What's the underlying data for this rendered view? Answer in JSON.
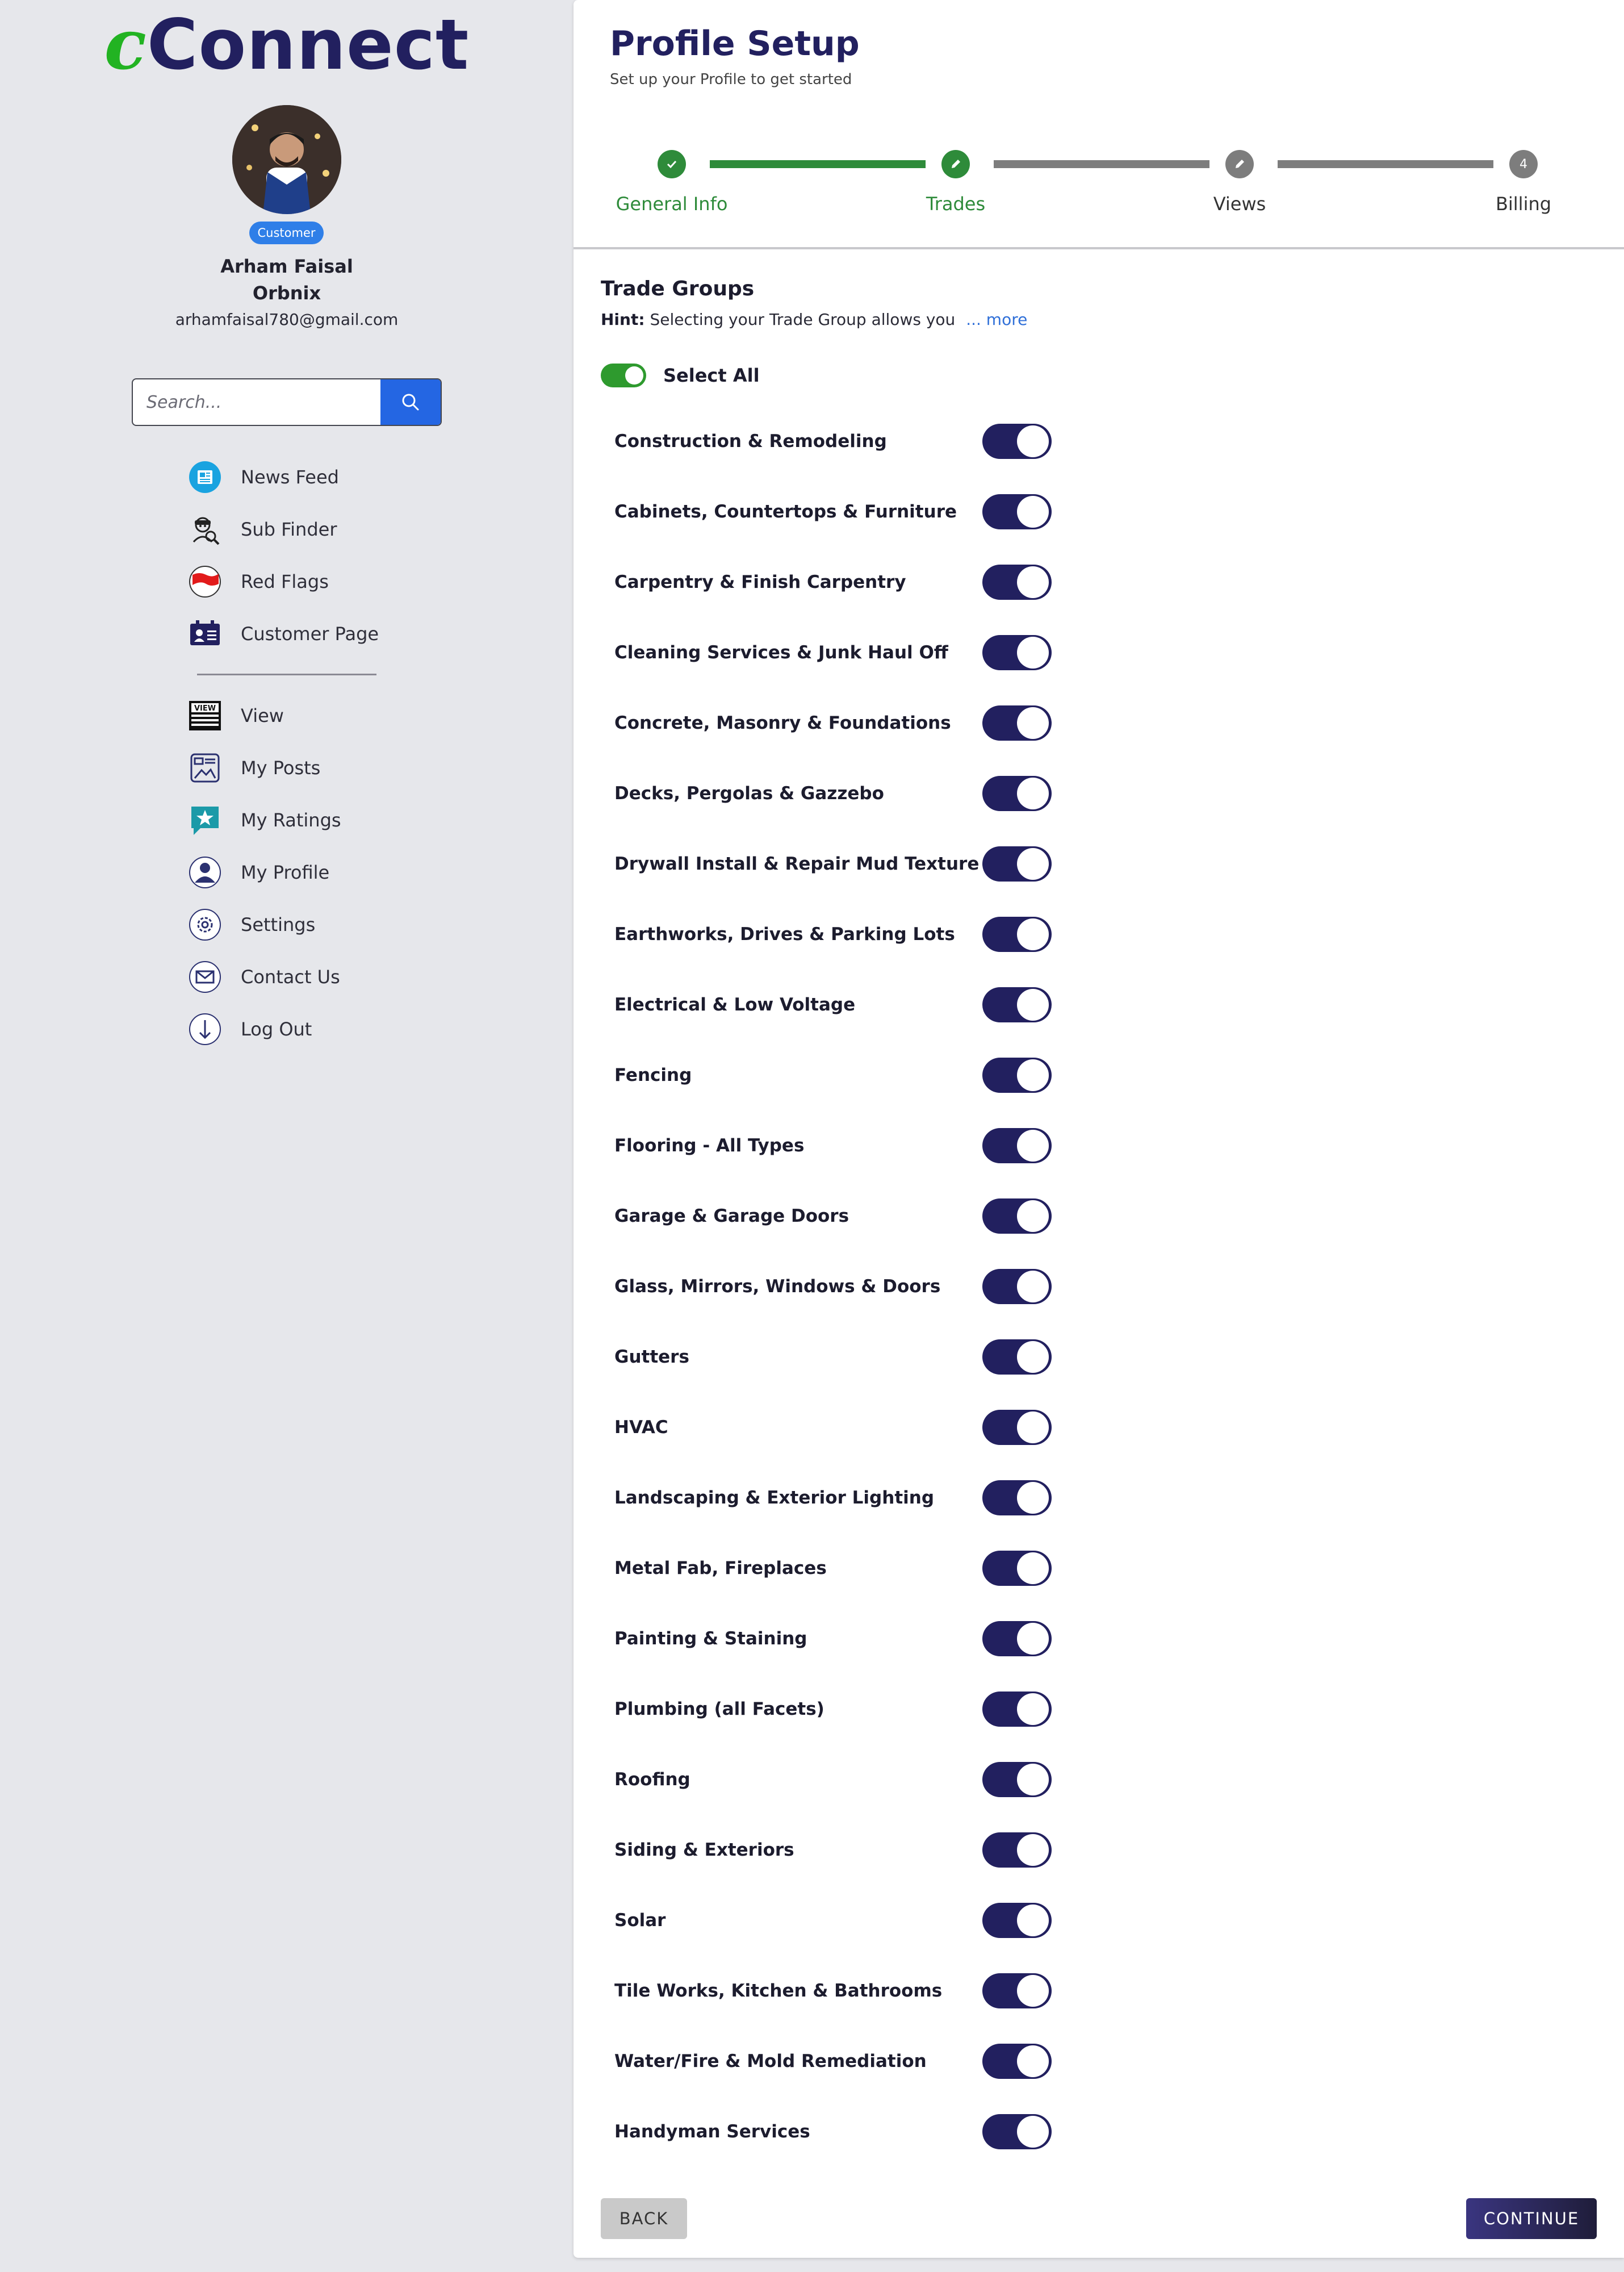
{
  "brand": {
    "logo_accent": "c",
    "logo_rest": "Connect"
  },
  "profile": {
    "badge": "Customer",
    "name": "Arham Faisal",
    "company": "Orbnix",
    "email": "arhamfaisal780@gmail.com"
  },
  "search": {
    "placeholder": "Search..."
  },
  "nav": {
    "primary": [
      {
        "label": "News Feed",
        "icon": "news-feed-icon"
      },
      {
        "label": "Sub Finder",
        "icon": "sub-finder-icon"
      },
      {
        "label": "Red Flags",
        "icon": "red-flag-icon"
      },
      {
        "label": "Customer Page",
        "icon": "customer-page-icon"
      }
    ],
    "secondary": [
      {
        "label": "View",
        "icon": "view-icon"
      },
      {
        "label": "My Posts",
        "icon": "my-posts-icon"
      },
      {
        "label": "My Ratings",
        "icon": "ratings-icon"
      },
      {
        "label": "My Profile",
        "icon": "profile-icon"
      },
      {
        "label": "Settings",
        "icon": "gear-icon"
      },
      {
        "label": "Contact Us",
        "icon": "mail-icon"
      },
      {
        "label": "Log Out",
        "icon": "logout-icon"
      }
    ]
  },
  "main": {
    "title": "Profile Setup",
    "subtitle": "Set up your Profile to get started",
    "steps": [
      {
        "label": "General Info",
        "marker": "",
        "status": "done"
      },
      {
        "label": "Trades",
        "marker": "",
        "status": "current"
      },
      {
        "label": "Views",
        "marker": "",
        "status": "pending"
      },
      {
        "label": "Billing",
        "marker": "4",
        "status": "pending"
      }
    ],
    "section_title": "Trade Groups",
    "hint_label": "Hint:",
    "hint_text": "Selecting your Trade Group allows you",
    "hint_more": "... more",
    "select_all_label": "Select All",
    "trades": [
      "Construction & Remodeling",
      "Cabinets, Countertops & Furniture",
      "Carpentry & Finish Carpentry",
      "Cleaning Services & Junk Haul Off",
      "Concrete, Masonry & Foundations",
      "Decks, Pergolas & Gazzebo",
      "Drywall Install & Repair Mud Texture",
      "Earthworks, Drives & Parking Lots",
      "Electrical & Low Voltage",
      "Fencing",
      "Flooring - All Types",
      "Garage & Garage Doors",
      "Glass, Mirrors, Windows & Doors",
      "Gutters",
      "HVAC",
      "Landscaping & Exterior Lighting",
      "Metal Fab, Fireplaces",
      "Painting & Staining",
      "Plumbing (all Facets)",
      "Roofing",
      "Siding & Exteriors",
      "Solar",
      "Tile Works, Kitchen & Bathrooms",
      "Water/Fire & Mold Remediation",
      "Handyman Services"
    ],
    "back_label": "BACK",
    "continue_label": "CONTINUE"
  },
  "colors": {
    "brand_navy": "#22205f",
    "accent_green": "#2e8b3a",
    "pending_gray": "#7d7d7d",
    "search_blue": "#2466e3"
  }
}
